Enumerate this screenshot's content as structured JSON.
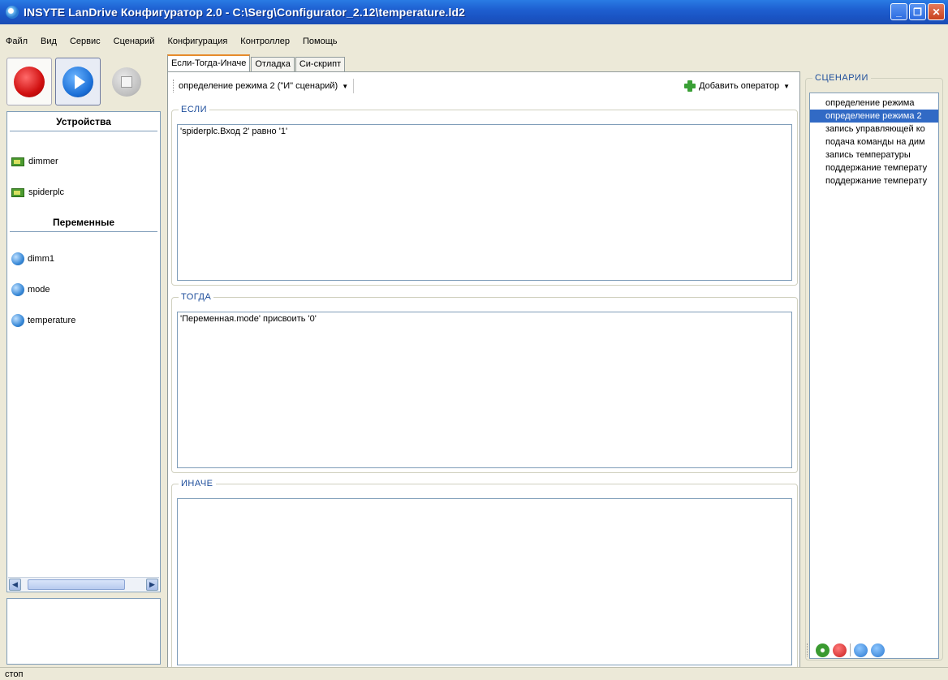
{
  "window": {
    "title": "INSYTE LanDrive Конфигуратор 2.0 - C:\\Serg\\Configurator_2.12\\temperature.ld2",
    "minimize": "_",
    "maximize": "❐",
    "close": "✕"
  },
  "menu": [
    "Файл",
    "Вид",
    "Сервис",
    "Сценарий",
    "Конфигурация",
    "Контроллер",
    "Помощь"
  ],
  "left_panel": {
    "devices_title": "Устройства",
    "devices": [
      "dimmer",
      "spiderplc"
    ],
    "variables_title": "Переменные",
    "variables": [
      "dimm1",
      "mode",
      "temperature"
    ]
  },
  "tabs": [
    "Если-Тогда-Иначе",
    "Отладка",
    "Си-скрипт"
  ],
  "toolbar": {
    "scenario_select": "определение режима 2  (\"И\" сценарий)",
    "add_operator": "Добавить оператор"
  },
  "if_group": {
    "legend": "ЕСЛИ",
    "text": "'spiderplc.Вход 2' равно '1'"
  },
  "then_group": {
    "legend": "ТОГДА",
    "text": "'Переменная.mode' присвоить '0'"
  },
  "else_group": {
    "legend": "ИНАЧЕ",
    "text": ""
  },
  "scenarios": {
    "legend": "СЦЕНАРИИ",
    "items": [
      "определение режима",
      "определение режима 2",
      "запись управляющей ко",
      "подача команды на дим",
      "запись температуры",
      "поддержание температу",
      "поддержание температу"
    ],
    "selected_index": 1
  },
  "status": "стоп"
}
